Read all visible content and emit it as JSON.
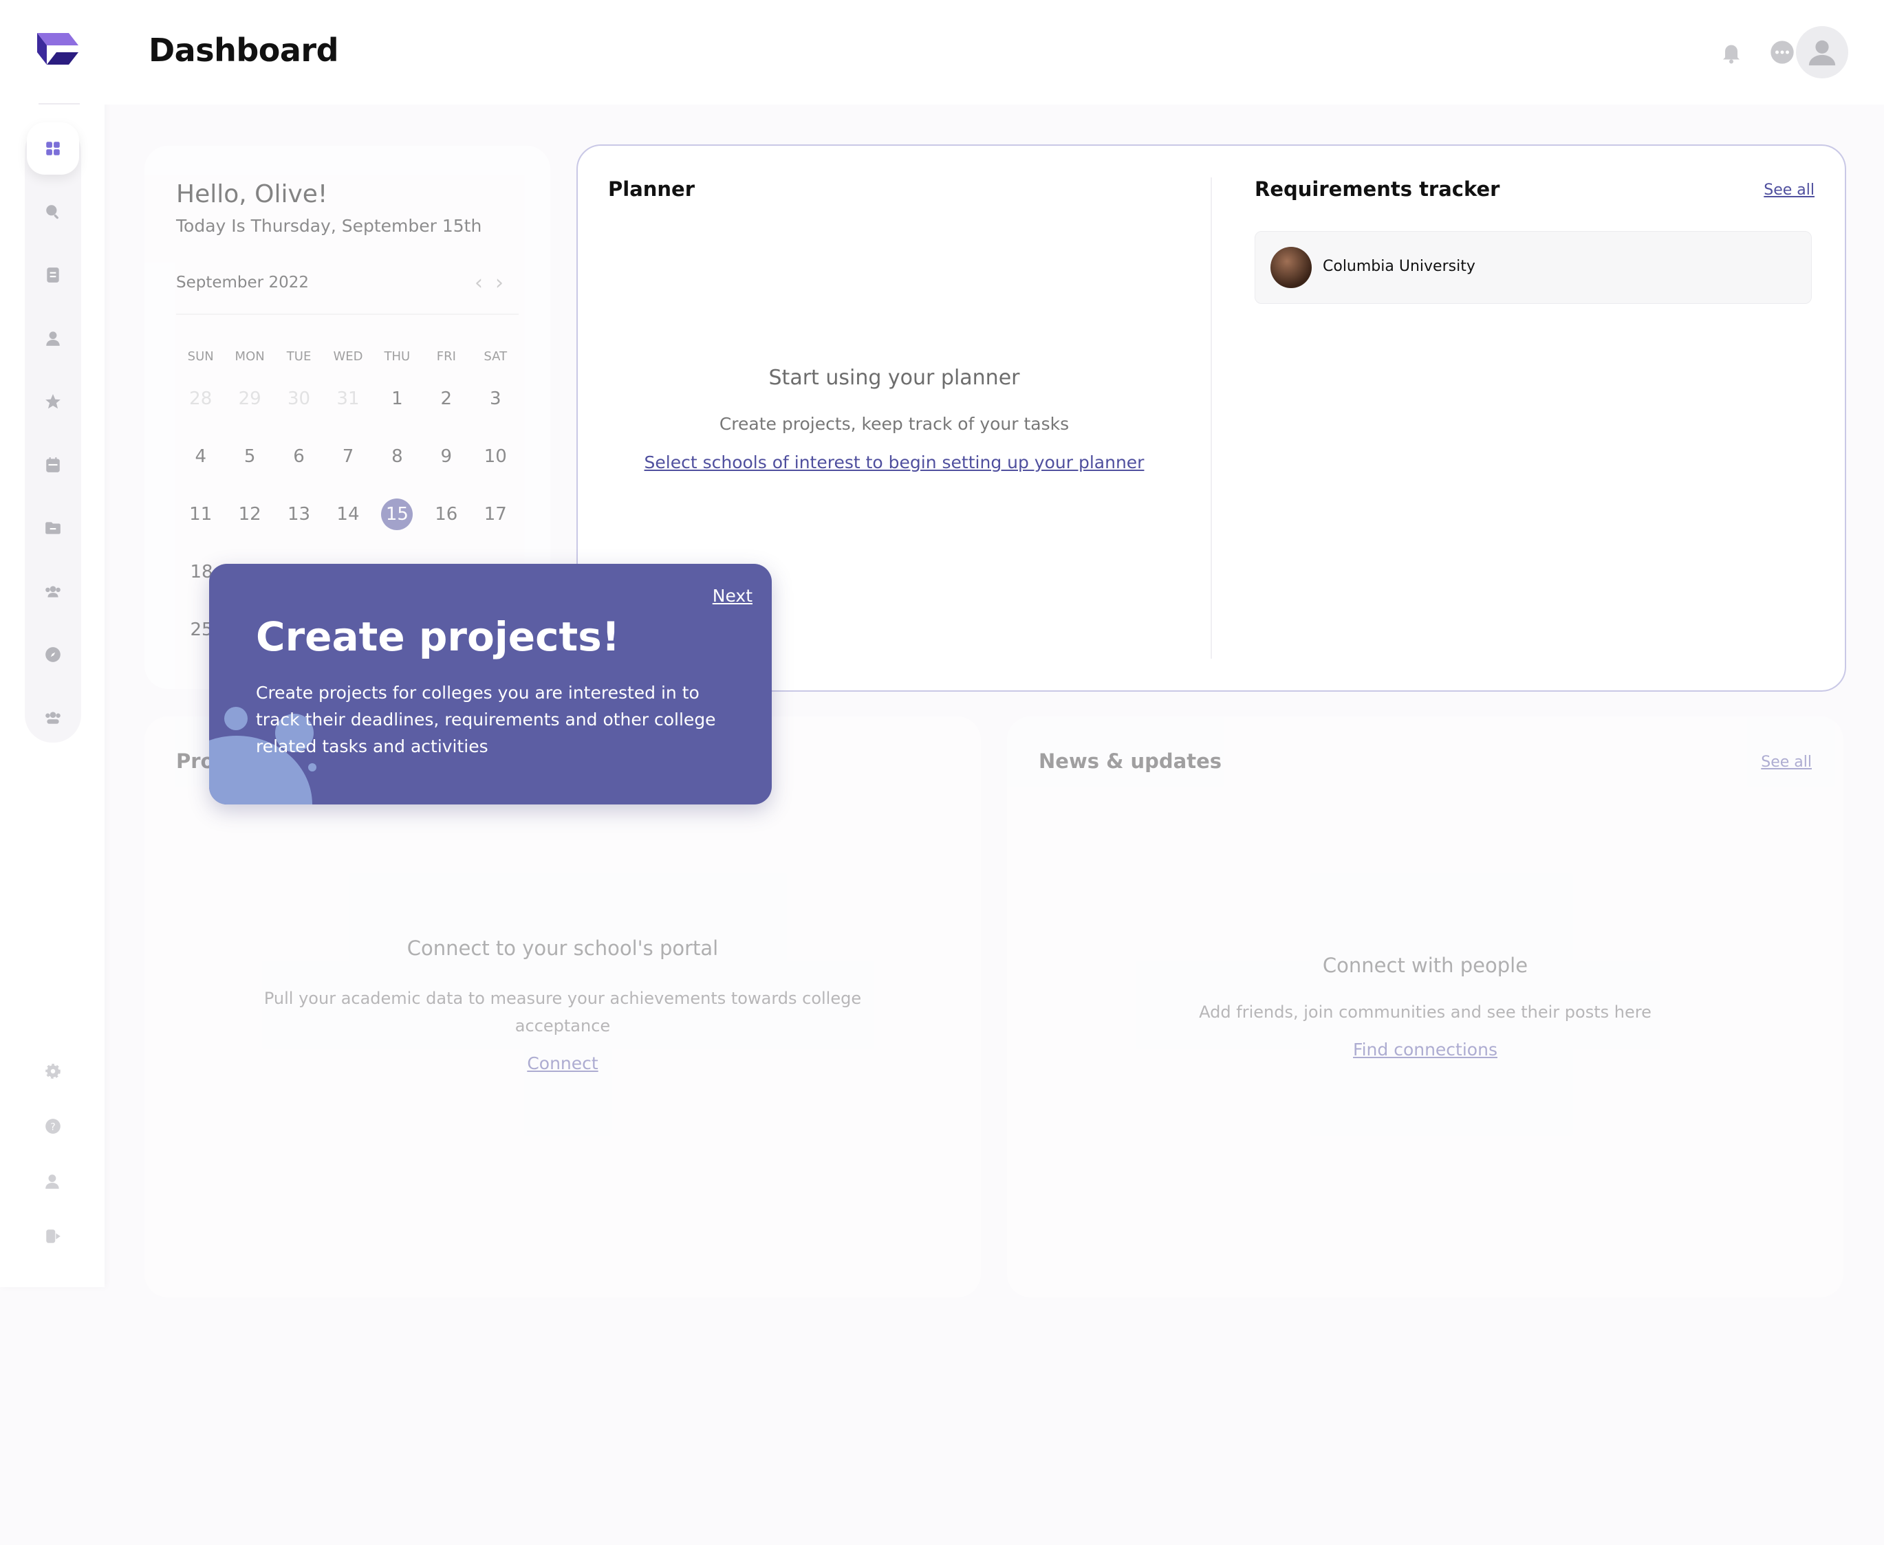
{
  "header": {
    "title": "Dashboard"
  },
  "sidebar": {
    "items": [
      {
        "icon": "grid-icon",
        "active": true
      },
      {
        "icon": "search-icon"
      },
      {
        "icon": "document-icon"
      },
      {
        "icon": "user-icon"
      },
      {
        "icon": "star-icon"
      },
      {
        "icon": "calendar-icon"
      },
      {
        "icon": "folder-icon"
      },
      {
        "icon": "group-icon"
      },
      {
        "icon": "compass-icon"
      },
      {
        "icon": "community-icon"
      }
    ],
    "bottom": [
      {
        "icon": "gear-icon"
      },
      {
        "icon": "help-icon"
      },
      {
        "icon": "account-icon"
      },
      {
        "icon": "logout-icon"
      }
    ]
  },
  "calendar": {
    "greeting": "Hello, Olive!",
    "subtitle": "Today Is Thursday, September 15th",
    "month": "September 2022",
    "weekdays": [
      "SUN",
      "MON",
      "TUE",
      "WED",
      "THU",
      "FRI",
      "SAT"
    ],
    "rows": [
      [
        "28",
        "29",
        "30",
        "31",
        "1",
        "2",
        "3"
      ],
      [
        "4",
        "5",
        "6",
        "7",
        "8",
        "9",
        "10"
      ],
      [
        "11",
        "12",
        "13",
        "14",
        "15",
        "16",
        "17"
      ],
      [
        "18",
        "",
        "",
        "",
        "",
        "",
        ""
      ],
      [
        "25",
        "",
        "",
        "",
        "",
        "",
        ""
      ]
    ],
    "today": "15"
  },
  "planner": {
    "title": "Planner",
    "empty_title": "Start using your planner",
    "empty_sub": "Create projects, keep track of your tasks",
    "link": "Select schools of interest to begin setting up your planner"
  },
  "requirements": {
    "title": "Requirements tracker",
    "see_all": "See all",
    "items": [
      {
        "name": "Columbia University"
      }
    ]
  },
  "progress": {
    "title": "Pro",
    "empty_title": "Connect to your school's portal",
    "empty_sub": "Pull your academic data to measure your achievements towards college acceptance",
    "link": "Connect"
  },
  "news": {
    "title": "News & updates",
    "see_all": "See all",
    "empty_title": "Connect with people",
    "empty_sub": "Add friends, join communities and see their posts here",
    "link": "Find connections"
  },
  "tooltip": {
    "next": "Next",
    "title": "Create projects!",
    "text": "Create projects for colleges you are interested in to track their deadlines, requirements and other college related tasks and activities"
  },
  "colors": {
    "accent": "#5c5ea3",
    "link": "#4f4f9e",
    "background": "#fbfafc"
  }
}
